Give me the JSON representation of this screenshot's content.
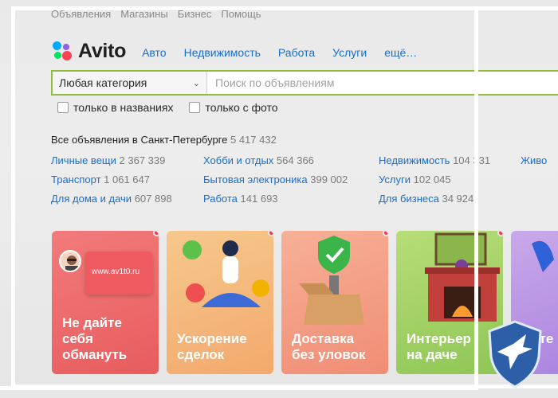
{
  "topnav": [
    "Объявления",
    "Магазины",
    "Бизнес",
    "Помощь"
  ],
  "logo": {
    "text": "Avito"
  },
  "mainnav": [
    "Авто",
    "Недвижимость",
    "Работа",
    "Услуги",
    "ещё…"
  ],
  "search": {
    "category": "Любая категория",
    "placeholder": "Поиск по объявлениям"
  },
  "filters": [
    "только в названиях",
    "только с фото"
  ],
  "total": {
    "label": "Все объявления в Санкт-Петербурге",
    "count": "5 417 432"
  },
  "categories": [
    {
      "name": "Личные вещи",
      "count": "2 367 339"
    },
    {
      "name": "Хобби и отдых",
      "count": "564 366"
    },
    {
      "name": "Недвижимость",
      "count": "104 331"
    },
    {
      "name": "Живо",
      "count": ""
    },
    {
      "name": "Транспорт",
      "count": "1 061 647"
    },
    {
      "name": "Бытовая электроника",
      "count": "399 002"
    },
    {
      "name": "Услуги",
      "count": "102 045"
    },
    {
      "name": "Для дома и дачи",
      "count": "607 898"
    },
    {
      "name": "Работа",
      "count": "141 693"
    },
    {
      "name": "Для бизнеса",
      "count": "34 924"
    }
  ],
  "cards": [
    {
      "title": "Не дайте\nсебя\nобмануть",
      "extra": "www.av1t0.ru"
    },
    {
      "title": "Ускорение\nсделок"
    },
    {
      "title": "Доставка\nбез уловок"
    },
    {
      "title": "Интерьер\nна даче"
    },
    {
      "title": "Инте\n%"
    }
  ],
  "icons": [
    "search-dropdown-chevron-icon",
    "avito-logo-icon",
    "shield-eagle-icon"
  ],
  "colors": {
    "link": "#1a6dc9",
    "search_border": "#8fbf3a",
    "notification_dot": "#ff2e54"
  }
}
